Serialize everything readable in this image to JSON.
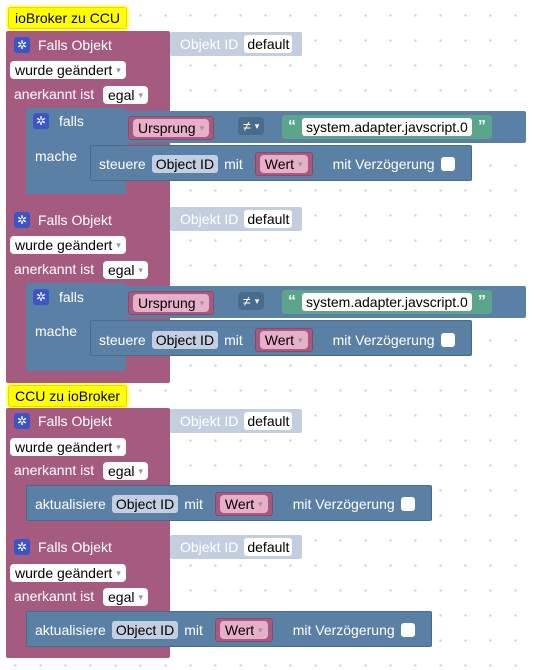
{
  "labels": {
    "section1": "ioBroker zu CCU",
    "section2": "CCU zu ioBroker"
  },
  "event": {
    "title": "Falls Objekt",
    "objekt_id_label": "Objekt ID",
    "objekt_id_value": "default",
    "trigger": "wurde geändert",
    "anerkannt_label": "anerkannt ist",
    "anerkannt_value": "egal"
  },
  "if_block": {
    "falls": "falls",
    "mache": "mache",
    "source": "Ursprung",
    "operator": "≠",
    "string_value": "system.adapter.javscript.0"
  },
  "actions": {
    "steuere": "steuere",
    "aktualisiere": "aktualisiere",
    "object_id": "Object ID",
    "mit": "mit",
    "wert": "Wert",
    "delay": "mit Verzögerung"
  },
  "colors": {
    "event": "#a55b80",
    "logic": "#5b80a5",
    "string": "#5ba58c",
    "label": "#ffff00"
  }
}
